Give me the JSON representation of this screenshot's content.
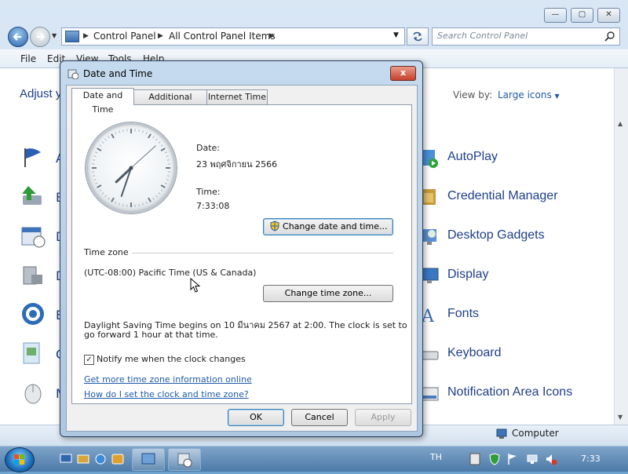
{
  "control_panel": {
    "breadcrumb": [
      "Control Panel",
      "All Control Panel Items"
    ],
    "search_placeholder": "Search Control Panel",
    "menu": [
      "File",
      "Edit",
      "View",
      "Tools",
      "Help"
    ],
    "heading": "Adjust y",
    "view_by_label": "View by:",
    "view_by_value": "Large icons",
    "items": [
      "AutoPlay",
      "Credential Manager",
      "Desktop Gadgets",
      "Display",
      "Fonts",
      "Keyboard",
      "Notification Area Icons"
    ],
    "left_letters": [
      "A",
      "B",
      "D",
      "D",
      "E",
      "C",
      "M"
    ],
    "status_computer": "Computer"
  },
  "dialog": {
    "title": "Date and Time",
    "close": "x",
    "tabs": [
      "Date and Time",
      "Additional Clocks",
      "Internet Time"
    ],
    "date_label": "Date:",
    "date_value": "23 พฤศจิกายน 2566",
    "time_label": "Time:",
    "time_value": "7:33:08",
    "change_datetime_button": "Change date and time...",
    "timezone_heading": "Time zone",
    "timezone_value": "(UTC-08:00) Pacific Time (US & Canada)",
    "change_timezone_button": "Change time zone...",
    "dst_text_line1": "Daylight Saving Time begins on 10 มีนาคม 2567 at 2:00. The clock is set to",
    "dst_text_line2": "go forward 1 hour at that time.",
    "notify_label": "Notify me when the clock changes",
    "notify_checked": true,
    "link_more": "Get more time zone information online",
    "link_how": "How do I set the clock and time zone?",
    "ok": "OK",
    "cancel": "Cancel",
    "apply": "Apply"
  },
  "taskbar": {
    "language": "TH",
    "clock": "7:33"
  },
  "clock_face": {
    "hour": 7,
    "minute": 33,
    "second": 8
  }
}
